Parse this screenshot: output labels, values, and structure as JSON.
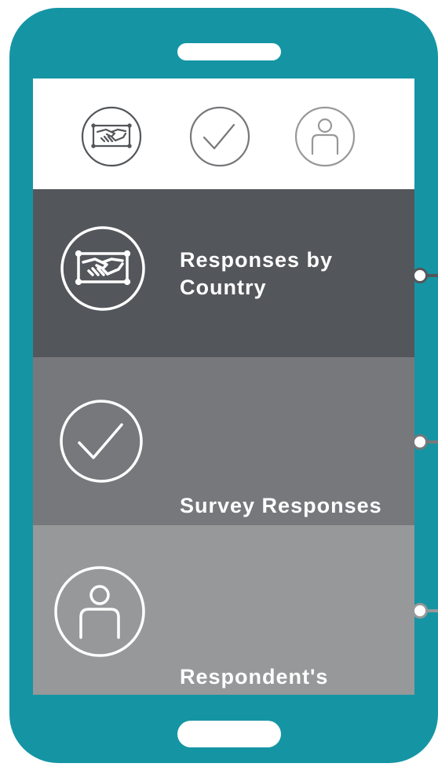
{
  "icons": {
    "top": [
      "handshake-icon",
      "checkmark-icon",
      "person-icon"
    ],
    "top_colors": [
      "#53565a",
      "#76787b",
      "#979899"
    ]
  },
  "menu": {
    "items": [
      {
        "label": "Responses by Country",
        "icon": "handshake-icon",
        "bg_color": "#53565a"
      },
      {
        "label": "Survey Responses",
        "icon": "checkmark-icon",
        "bg_color": "#76787b"
      },
      {
        "label": "Respondent's Role",
        "icon": "person-icon",
        "bg_color": "#979899"
      }
    ]
  },
  "colors": {
    "phone_body": "#1595a4",
    "screen": "#ffffff",
    "text": "#ffffff"
  }
}
